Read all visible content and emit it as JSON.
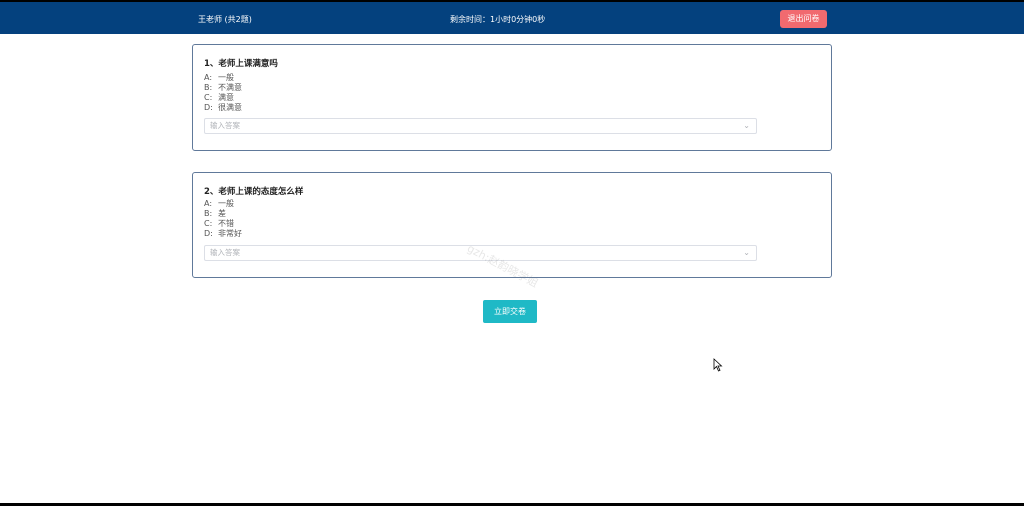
{
  "header": {
    "title": "王老师 (共2题)",
    "timer": "剩余时间：1小时0分钟0秒",
    "exit_label": "退出问卷"
  },
  "questions": [
    {
      "title": "1、老师上课满意吗",
      "options": [
        {
          "key": "A:",
          "text": "一般"
        },
        {
          "key": "B:",
          "text": "不满意"
        },
        {
          "key": "C:",
          "text": "满意"
        },
        {
          "key": "D:",
          "text": "很满意"
        }
      ],
      "answer_placeholder": "输入答案"
    },
    {
      "title": "2、老师上课的态度怎么样",
      "options": [
        {
          "key": "A:",
          "text": "一般"
        },
        {
          "key": "B:",
          "text": "差"
        },
        {
          "key": "C:",
          "text": "不错"
        },
        {
          "key": "D:",
          "text": "非常好"
        }
      ],
      "answer_placeholder": "输入答案"
    }
  ],
  "submit_label": "立即交卷",
  "watermark": "gzh:赵韵晓学姐",
  "colors": {
    "header_bg": "#04417e",
    "exit_button": "#f16a6f",
    "submit_button": "#1fb9c6",
    "card_border": "#60799a"
  }
}
